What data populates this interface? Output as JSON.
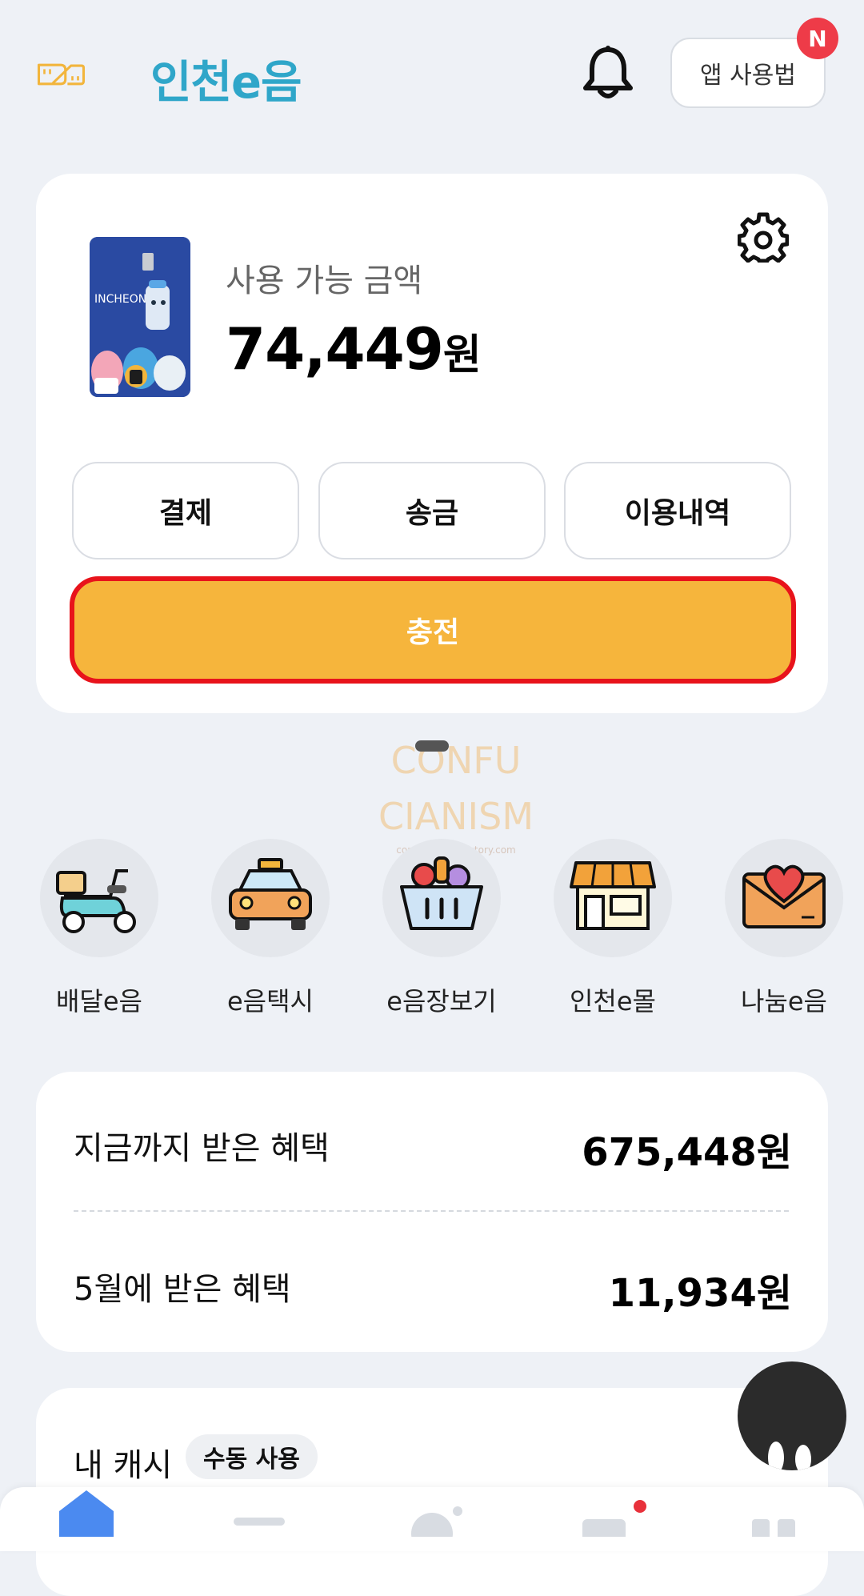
{
  "header": {
    "logo_text": "인천e음",
    "guide_label": "앱 사용법",
    "badge": "N"
  },
  "balance": {
    "label": "사용 가능 금액",
    "amount": "74,449",
    "unit": "원"
  },
  "actions": [
    {
      "label": "결제"
    },
    {
      "label": "송금"
    },
    {
      "label": "이용내역"
    }
  ],
  "charge_label": "충전",
  "watermark": {
    "line1": "CONFU",
    "line2": "CIANISM",
    "url": "confucianism.tistory.com"
  },
  "services": [
    {
      "label": "배달e음",
      "icon": "scooter-icon"
    },
    {
      "label": "e음택시",
      "icon": "taxi-icon"
    },
    {
      "label": "e음장보기",
      "icon": "grocery-basket-icon"
    },
    {
      "label": "인천e몰",
      "icon": "store-icon"
    },
    {
      "label": "나눔e음",
      "icon": "heart-envelope-icon"
    }
  ],
  "benefits": {
    "total_label": "지금까지 받은 혜택",
    "total_value": "675,448원",
    "month_label": "5월에 받은 혜택",
    "month_value": "11,934원"
  },
  "my_cash": {
    "title": "내 캐시",
    "mode": "수동 사용"
  },
  "colors": {
    "background": "#eef1f6",
    "charge": "#f6b53c",
    "highlight_border": "#e8131b",
    "brand_teal": "#2fa6c9",
    "brand_yellow": "#f2b53c"
  }
}
